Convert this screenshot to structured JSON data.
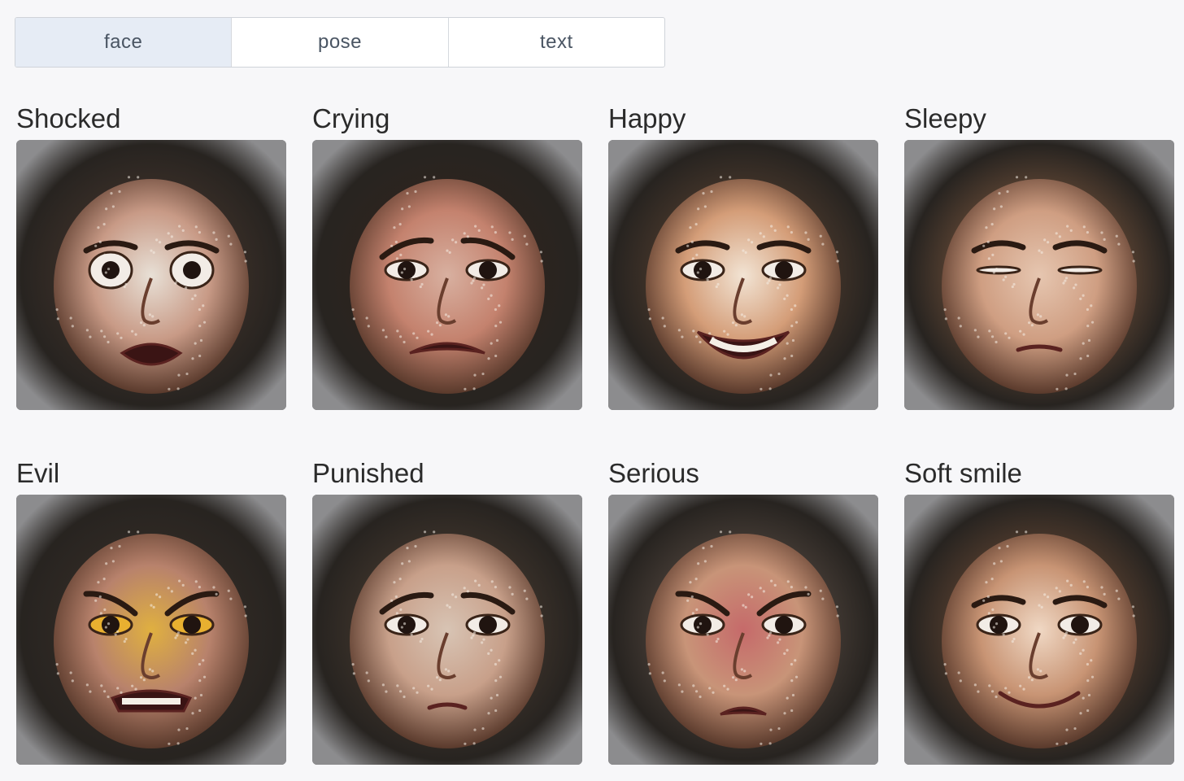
{
  "tabs": [
    {
      "label": "face",
      "active": true
    },
    {
      "label": "pose",
      "active": false
    },
    {
      "label": "text",
      "active": false
    }
  ],
  "cards": [
    {
      "title": "Shocked",
      "skin": "#c89a86",
      "hair": "#3a2c24",
      "accent": "#e8e0d6"
    },
    {
      "title": "Crying",
      "skin": "#c4826e",
      "hair": "#2a1e18",
      "accent": "#d8b0a0"
    },
    {
      "title": "Happy",
      "skin": "#d49d78",
      "hair": "#4a3628",
      "accent": "#f2e4d4"
    },
    {
      "title": "Sleepy",
      "skin": "#cf9e82",
      "hair": "#6a4a34",
      "accent": "#e6c6b0"
    },
    {
      "title": "Evil",
      "skin": "#b8826c",
      "hair": "#2e2620",
      "accent": "#e0b040"
    },
    {
      "title": "Punished",
      "skin": "#c8a08a",
      "hair": "#3e3228",
      "accent": "#d8c4b4"
    },
    {
      "title": "Serious",
      "skin": "#c89478",
      "hair": "#4c4038",
      "accent": "#c66a6a"
    },
    {
      "title": "Soft smile",
      "skin": "#c89474",
      "hair": "#5a3e2c",
      "accent": "#f0d8c4"
    }
  ]
}
